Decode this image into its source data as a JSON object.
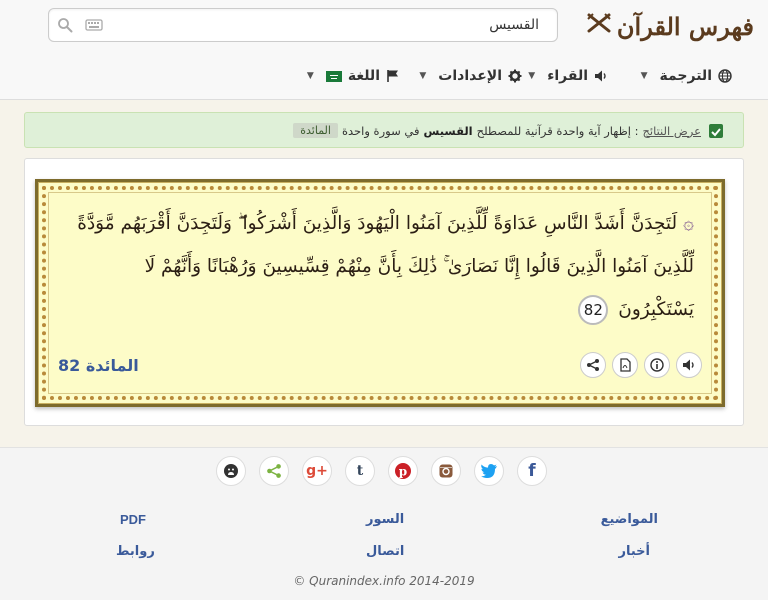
{
  "header": {
    "logo_text": "فهرس القرآن",
    "search": {
      "value": "القسيس",
      "placeholder": ""
    },
    "nav": {
      "translation": "الترجمة",
      "reciters": "القراء",
      "settings": "الإعدادات",
      "language": "اللغة"
    }
  },
  "notice": {
    "prefix": "عرض النتائج",
    "sentence": ": إظهار آية واحدة قرآنية للمصطلح",
    "term": "القسيس",
    "suffix": "في سورة واحدة",
    "sura_tag": "المائدة"
  },
  "verse": {
    "text": "لَتَجِدَنَّ أَشَدَّ النَّاسِ عَدَاوَةً لِّلَّذِينَ آمَنُوا الْيَهُودَ وَالَّذِينَ أَشْرَكُوا ۖ وَلَتَجِدَنَّ أَقْرَبَهُم مَّوَدَّةً لِّلَّذِينَ آمَنُوا الَّذِينَ قَالُوا إِنَّا نَصَارَىٰ ۚ ذَٰلِكَ بِأَنَّ مِنْهُمْ قِسِّيسِينَ وَرُهْبَانًا وَأَنَّهُمْ لَا يَسْتَكْبِرُونَ",
    "number": "82",
    "sura_ref": "المائدة 82"
  },
  "footer": {
    "links": {
      "topics": "المواضيع",
      "suras": "السور",
      "pdf": "PDF",
      "news": "أخبار",
      "contact": "اتصال",
      "links": "روابط"
    },
    "copyright": "© Quranindex.info 2014-2019"
  }
}
